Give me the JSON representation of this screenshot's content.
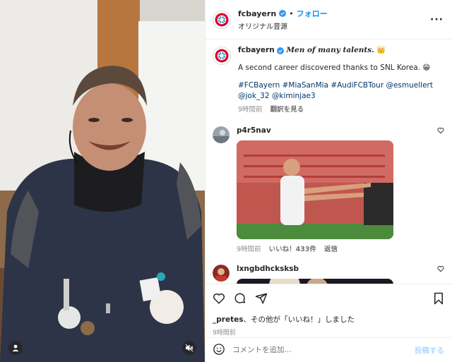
{
  "header": {
    "username": "fcbayern",
    "separator": "•",
    "follow_label": "フォロー",
    "audio_label": "オリジナル音源",
    "more_label": "···"
  },
  "caption": {
    "username": "fcbayern",
    "title": "Men of many talents.",
    "title_emoji": "👑",
    "line1": "A second career discovered thanks to SNL Korea. 😁",
    "hashtags": "#FCBayern #MiaSanMia #AudiFCBTour @esmuellert @jok_32 @kiminjae3",
    "time": "9時間前",
    "translate_label": "翻訳を見る"
  },
  "comments": [
    {
      "username": "p4r5nav",
      "time": "9時間前",
      "likes": "いいね！433件",
      "reply_label": "返信"
    },
    {
      "username": "lxngbdhcksksb"
    }
  ],
  "likes_line": {
    "user": "_pretes",
    "rest": "、その他が「いいね！」しました"
  },
  "post_time": "9時間前",
  "add_comment": {
    "placeholder": "コメントを追加...",
    "post_label": "投稿する"
  },
  "colors": {
    "link": "#0095f6",
    "verified": "#3897f0",
    "muted": "#8e8e8e",
    "hashtag": "#00376b",
    "fcb_red": "#dc052d"
  },
  "icons": {
    "like": "heart-icon",
    "comment": "comment-icon",
    "share": "share-icon",
    "save": "bookmark-icon",
    "emoji": "emoji-icon",
    "mute": "mute-icon"
  }
}
